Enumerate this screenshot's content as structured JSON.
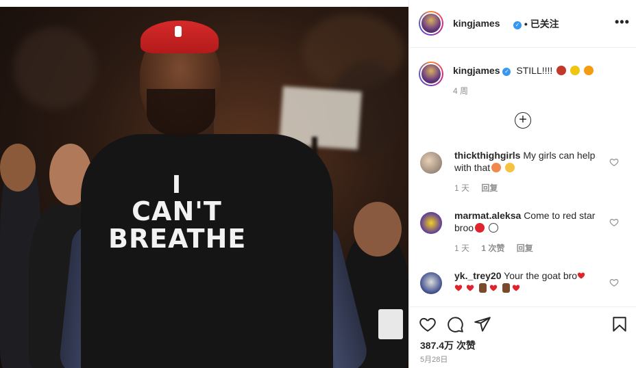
{
  "post": {
    "shirt_text": [
      "I",
      "CAN'T",
      "BREATHE"
    ]
  },
  "header": {
    "username": "kingjames",
    "separator": "•",
    "follow_status": "已关注",
    "more_icon": "more-horizontal-icon"
  },
  "caption": {
    "username": "kingjames",
    "text": "STILL!!!!",
    "emojis": [
      "angry-face-emoji",
      "sad-face-emoji",
      "fuming-face-emoji"
    ],
    "time": "4 周"
  },
  "load_more_icon": "plus-circle-icon",
  "comments": [
    {
      "username": "thickthighgirls",
      "text": "My girls can help with that",
      "emojis": [
        "peach-emoji",
        "praying-hands-emoji"
      ],
      "time": "1 天",
      "likes": "",
      "reply": "回复"
    },
    {
      "username": "marmat.aleksa",
      "text": "Come to red star broo",
      "emojis": [
        "red-circle-emoji",
        "white-circle-emoji"
      ],
      "time": "1 天",
      "likes": "1 次赞",
      "reply": "回复"
    },
    {
      "username": "yk._trey20",
      "text": "Your the goat bro",
      "emojis": [
        "red-heart-emoji",
        "red-heart-emoji",
        "red-heart-emoji",
        "thumbs-up-emoji",
        "red-heart-emoji",
        "thumbs-up-emoji",
        "red-heart-emoji"
      ],
      "time": "",
      "likes": "",
      "reply": ""
    }
  ],
  "actions": {
    "like_icon": "heart-outline-icon",
    "comment_icon": "comment-icon",
    "share_icon": "paper-plane-icon",
    "save_icon": "bookmark-icon",
    "likes_count": "387.4万",
    "likes_label": "次赞",
    "date": "5月28日"
  },
  "colors": {
    "verified": "#3897f0",
    "headband": "#d62a2a",
    "text": "#262626",
    "muted": "#8e8e8e"
  }
}
